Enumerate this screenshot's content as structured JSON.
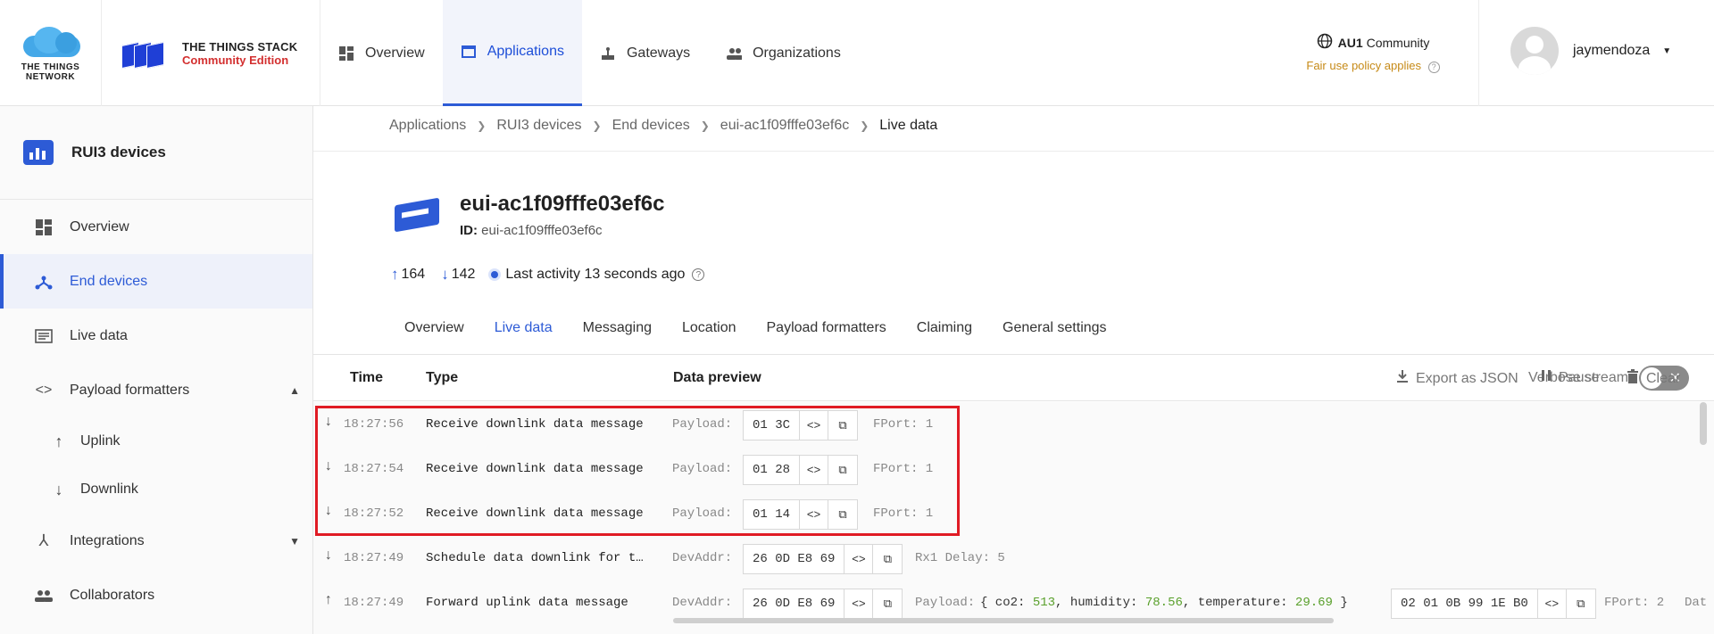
{
  "header": {
    "ttn_logo_text": "THE THINGS NETWORK",
    "tts_line1": "THE THINGS STACK",
    "tts_line2": "Community Edition",
    "nav": [
      {
        "label": "Overview",
        "icon": "dashboard-icon",
        "active": false
      },
      {
        "label": "Applications",
        "icon": "applications-icon",
        "active": true
      },
      {
        "label": "Gateways",
        "icon": "gateway-icon",
        "active": false
      },
      {
        "label": "Organizations",
        "icon": "organizations-icon",
        "active": false
      }
    ],
    "network": {
      "cluster": "AU1",
      "edition": "Community",
      "policy": "Fair use policy applies"
    },
    "user": {
      "name": "jaymendoza"
    }
  },
  "sidebar": {
    "app_name": "RUI3 devices",
    "items": [
      {
        "label": "Overview"
      },
      {
        "label": "End devices"
      },
      {
        "label": "Live data"
      },
      {
        "label": "Payload formatters"
      },
      {
        "label": "Uplink"
      },
      {
        "label": "Downlink"
      },
      {
        "label": "Integrations"
      },
      {
        "label": "Collaborators"
      }
    ]
  },
  "breadcrumb": [
    "Applications",
    "RUI3 devices",
    "End devices",
    "eui-ac1f09fffe03ef6c",
    "Live data"
  ],
  "device": {
    "title": "eui-ac1f09fffe03ef6c",
    "id_label": "ID:",
    "id_value": "eui-ac1f09fffe03ef6c",
    "uplinks": "164",
    "downlinks": "142",
    "last_activity": "Last activity 13 seconds ago"
  },
  "tabs": [
    "Overview",
    "Live data",
    "Messaging",
    "Location",
    "Payload formatters",
    "Claiming",
    "General settings"
  ],
  "table": {
    "headers": {
      "time": "Time",
      "type": "Type",
      "preview": "Data preview"
    },
    "verbose_label": "Verbose stream",
    "export_label": "Export as JSON",
    "pause_label": "Pause",
    "clear_label": "Clear",
    "rows": [
      {
        "time": "18:27:56",
        "type": "Receive downlink data message",
        "label": "Payload:",
        "value": "01 3C",
        "extra": "FPort: 1"
      },
      {
        "time": "18:27:54",
        "type": "Receive downlink data message",
        "label": "Payload:",
        "value": "01 28",
        "extra": "FPort: 1"
      },
      {
        "time": "18:27:52",
        "type": "Receive downlink data message",
        "label": "Payload:",
        "value": "01 14",
        "extra": "FPort: 1"
      },
      {
        "time": "18:27:49",
        "type": "Schedule data downlink for t…",
        "label": "DevAddr:",
        "value": "26 0D E8 69",
        "extra": "Rx1 Delay: 5"
      },
      {
        "time": "18:27:49",
        "type": "Forward uplink data message",
        "label": "DevAddr:",
        "value": "26 0D E8 69",
        "payload_label": "Payload:",
        "p_open": "{ co2:",
        "co2": "513",
        "p_hum": ", humidity:",
        "humidity": "78.56",
        "p_temp": ", temperature:",
        "temperature": "29.69",
        "p_close": "}",
        "raw": "02 01 0B 99 1E B0",
        "fport": "FPort: 2",
        "trunc": "Dat"
      }
    ]
  },
  "colors": {
    "accent": "#2d5bd6",
    "highlight": "#e01b24",
    "json_number": "#5aa02c"
  }
}
